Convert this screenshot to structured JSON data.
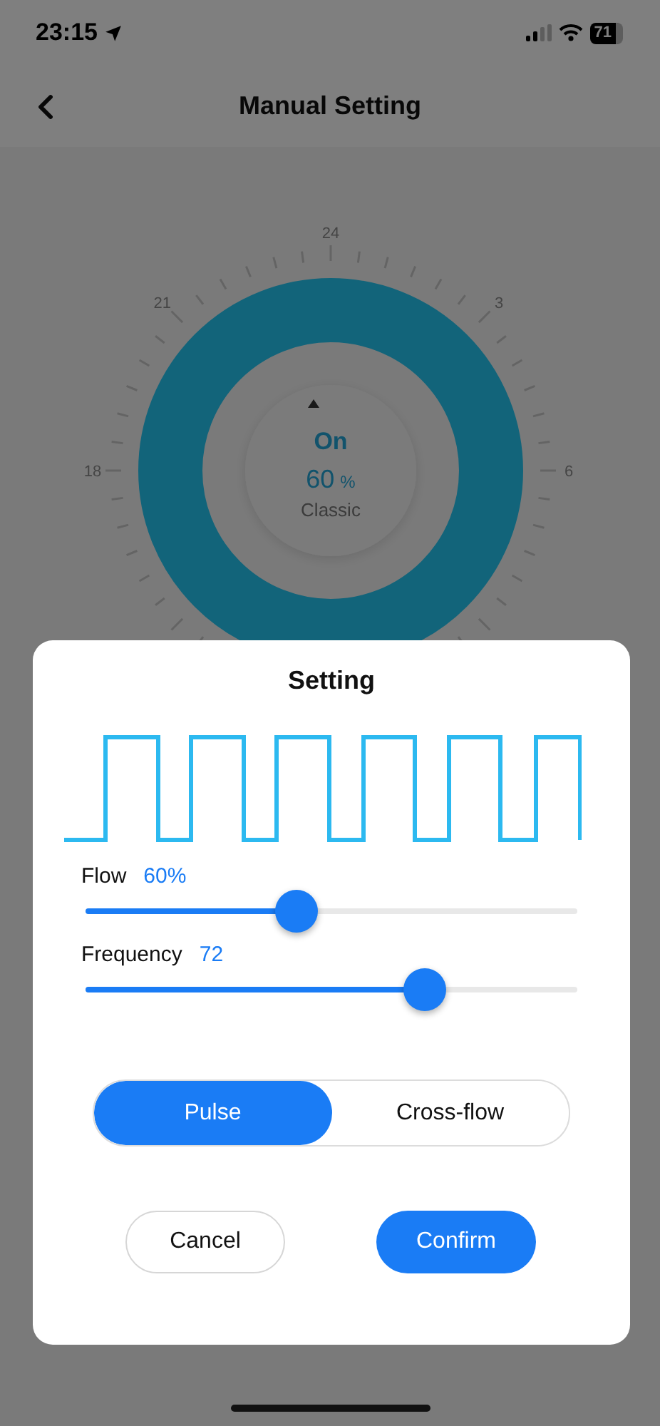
{
  "status_bar": {
    "time": "23:15",
    "battery": "71"
  },
  "nav": {
    "title": "Manual Setting"
  },
  "dial": {
    "hour_labels": [
      "24",
      "3",
      "6",
      "18",
      "21"
    ],
    "state": "On",
    "value": "60",
    "unit": "%",
    "mode": "Classic"
  },
  "dialog": {
    "title": "Setting",
    "sliders": [
      {
        "label": "Flow",
        "reading": "60%",
        "level": 0.43
      },
      {
        "label": "Frequency",
        "reading": "72",
        "level": 0.69
      }
    ],
    "modes": [
      {
        "label": "Pulse",
        "selected": true
      },
      {
        "label": "Cross-flow",
        "selected": false
      }
    ],
    "buttons": [
      {
        "label": "Cancel",
        "kind": "secondary"
      },
      {
        "label": "Confirm",
        "kind": "primary"
      }
    ]
  }
}
